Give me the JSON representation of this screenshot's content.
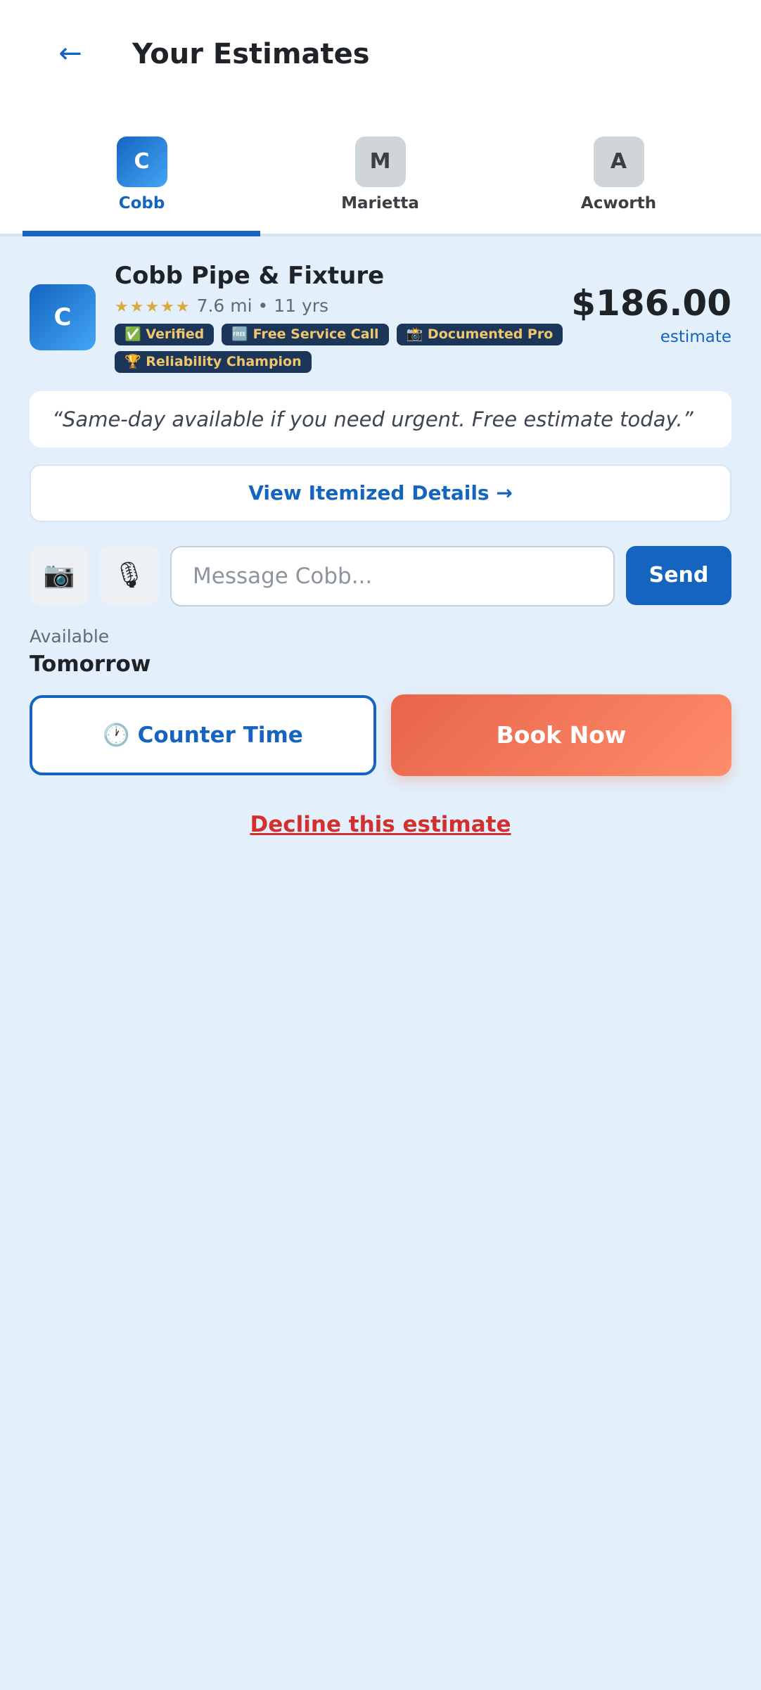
{
  "header": {
    "back_icon": "←",
    "title": "Your Estimates"
  },
  "tabs": [
    {
      "initial": "C",
      "label": "Cobb",
      "active": true
    },
    {
      "initial": "M",
      "label": "Marietta",
      "active": false
    },
    {
      "initial": "A",
      "label": "Acworth",
      "active": false
    }
  ],
  "estimate": {
    "initial": "C",
    "name": "Cobb Pipe & Fixture",
    "stars": "★★★★★",
    "rating": 5,
    "meta": "7.6 mi • 11 yrs",
    "badges": [
      "✅ Verified",
      "🆓 Free Service Call",
      "📸 Documented Pro",
      "🏆 Reliability Champion"
    ],
    "price": "$186.00",
    "price_label": "estimate",
    "quote": "“Same-day available if you need urgent. Free estimate today.”",
    "details_button": "View Itemized Details →",
    "message": {
      "camera_icon": "📷",
      "mic_icon": "🎙",
      "placeholder": "Message Cobb...",
      "send_label": "Send"
    },
    "availability_label": "Available",
    "availability_value": "Tomorrow",
    "counter_button": "🕐 Counter Time",
    "book_button": "Book Now",
    "decline_link": "Decline this estimate"
  },
  "colors": {
    "primary": "#1565c0",
    "accent": "#e8654a",
    "background": "#e3f0fb",
    "badge_bg": "#1b3659",
    "badge_text": "#f1c66c",
    "danger": "#d32f2f"
  }
}
